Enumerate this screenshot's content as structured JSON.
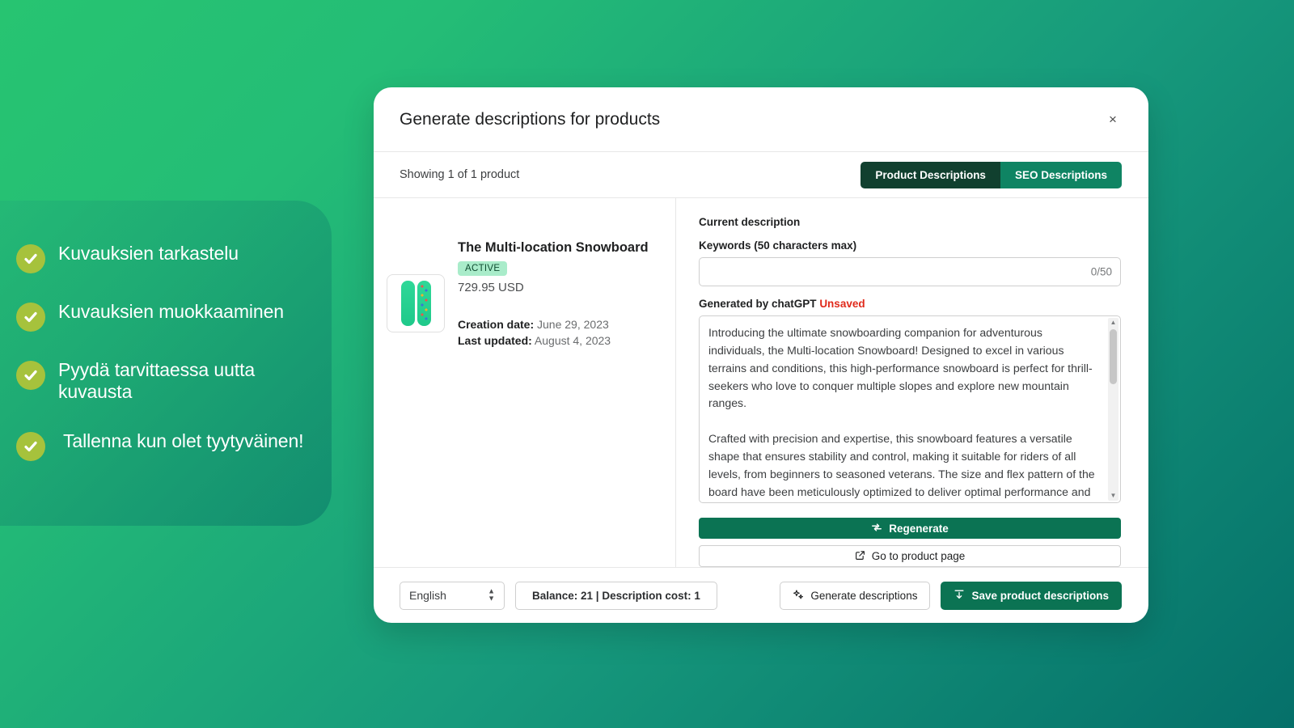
{
  "features": [
    {
      "icon": "check-circle-icon",
      "label": "Kuvauksien tarkastelu"
    },
    {
      "icon": "check-circle-icon",
      "label": "Kuvauksien muokkaaminen"
    },
    {
      "icon": "check-circle-icon",
      "label": "Pyydä tarvittaessa uutta kuvausta"
    },
    {
      "icon": "check-circle-icon",
      "label": "Tallenna kun olet tyytyväinen!"
    }
  ],
  "modal": {
    "title": "Generate descriptions for products",
    "close_label": "×",
    "showing_text": "Showing 1 of 1 product",
    "tabs": [
      {
        "label": "Product Descriptions",
        "active": true
      },
      {
        "label": "SEO Descriptions",
        "active": false
      }
    ],
    "product": {
      "name": "The Multi-location Snowboard",
      "status": "ACTIVE",
      "price": "729.95 USD",
      "creation_label": "Creation date:",
      "creation_date": "June 29, 2023",
      "updated_label": "Last updated:",
      "updated_date": "August 4, 2023"
    },
    "description_panel": {
      "current_description_label": "Current description",
      "keywords_label": "Keywords (50 characters max)",
      "keywords_value": "",
      "keywords_placeholder": "",
      "keywords_counter": "0/50",
      "generated_label": "Generated by chatGPT",
      "unsaved_label": "Unsaved",
      "generated_text": "Introducing the ultimate snowboarding companion for adventurous individuals, the Multi-location Snowboard! Designed to excel in various terrains and conditions, this high-performance snowboard is perfect for thrill-seekers who love to conquer multiple slopes and explore new mountain ranges.\n\nCrafted with precision and expertise, this snowboard features a versatile shape that ensures stability and control, making it suitable for riders of all levels, from beginners to seasoned veterans. The size and flex pattern of the board have been meticulously optimized to deliver optimal performance and maximize your riding experience.\n\nOne of the standout features of this snowboard is its innovative base technology.",
      "regenerate_label": "Regenerate",
      "go_to_product_label": "Go to product page"
    },
    "footer": {
      "language_value": "English",
      "balance_text": "Balance: 21 | Description cost: 1",
      "generate_label": "Generate descriptions",
      "save_label": "Save product descriptions"
    }
  },
  "colors": {
    "brand_green": "#0b7353",
    "tab_active": "#11402f",
    "tab_inactive": "#0f8463",
    "unsaved_red": "#e02a1b",
    "badge_bg": "#a9ecca",
    "check_badge": "#a6c23c",
    "bg_start": "#27c471",
    "bg_end": "#05706a"
  }
}
